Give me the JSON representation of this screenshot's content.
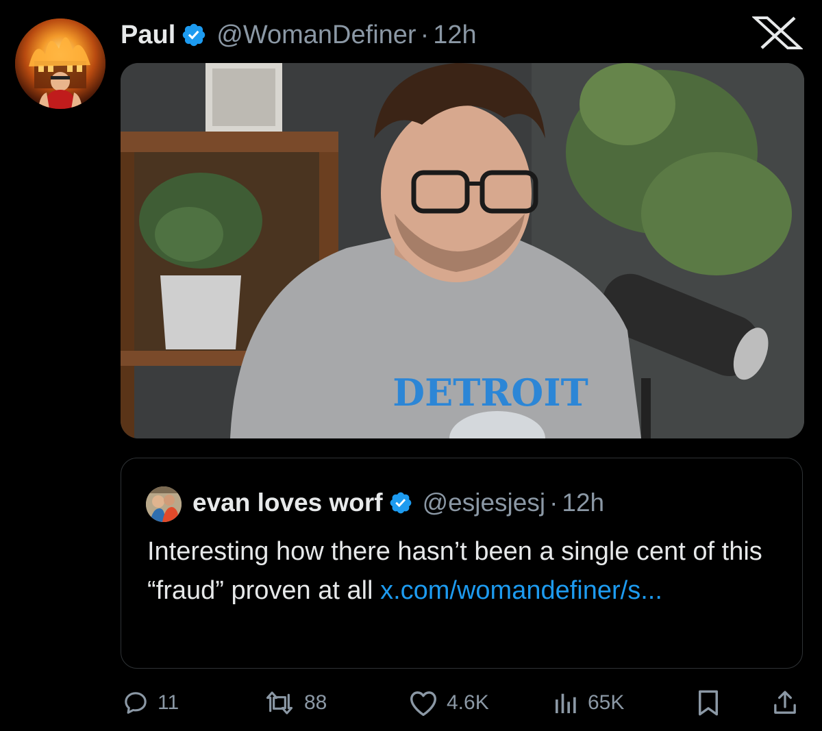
{
  "post": {
    "author": {
      "display_name": "Paul",
      "handle": "@WomanDefiner",
      "separator": "·",
      "time": "12h",
      "verified": true
    },
    "platform_icon": "x-logo-icon",
    "media": {
      "description_icon": "photo",
      "shirt_text": "DETROIT"
    },
    "quote": {
      "author": {
        "display_name": "evan loves worf",
        "handle": "@esjesjesj",
        "separator": "·",
        "time": "12h",
        "verified": true
      },
      "text": "Interesting how there hasn’t been a single cent of this “fraud” proven at all ",
      "link_text": "x.com/​womandefiner/s..."
    },
    "actions": {
      "replies": "11",
      "reposts": "88",
      "likes": "4.6K",
      "views": "65K"
    }
  },
  "colors": {
    "background": "#000000",
    "primary_text": "#e7e9ea",
    "secondary_text": "#8b98a5",
    "link": "#1d9bf0",
    "verified_badge": "#1d9bf0",
    "border": "#2f3336"
  }
}
